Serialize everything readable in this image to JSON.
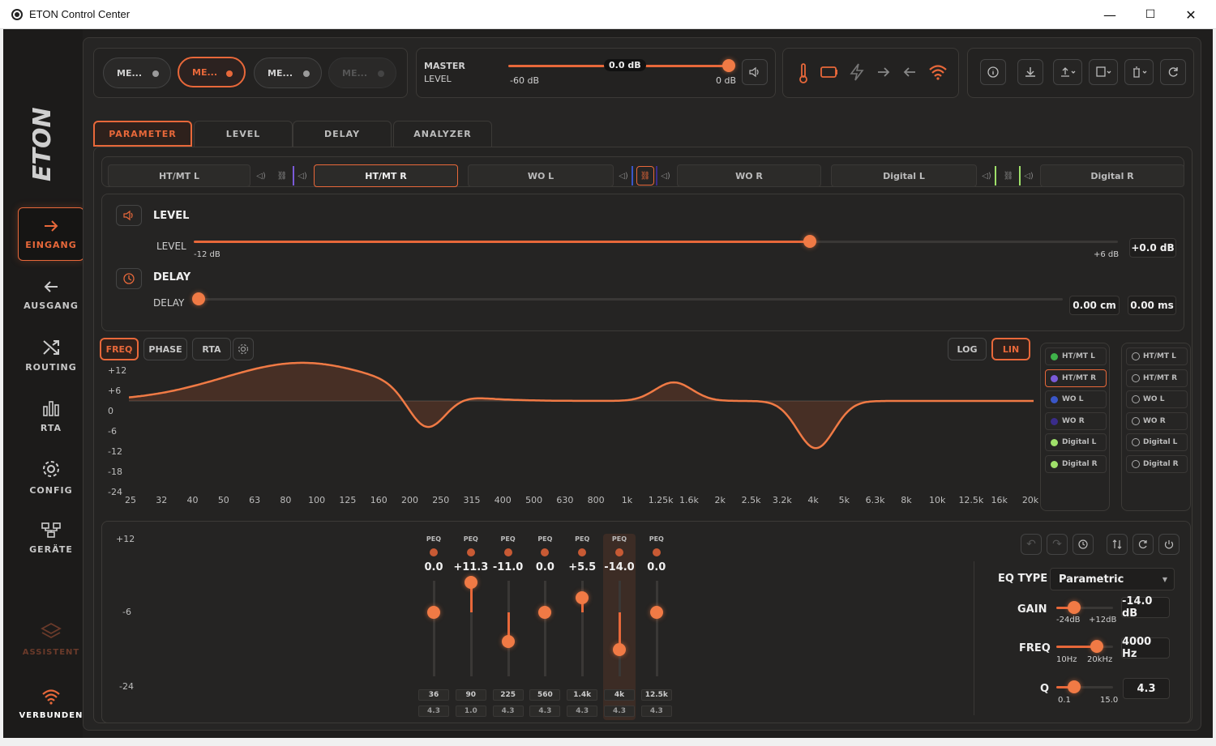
{
  "window": {
    "title": "ETON Control Center",
    "minimize": "—",
    "maximize": "☐",
    "close": "✕"
  },
  "sidebar": {
    "logo": "ETON",
    "items": [
      {
        "label": "EINGANG",
        "icon": "arrow-right-icon"
      },
      {
        "label": "AUSGANG",
        "icon": "arrow-left-icon"
      },
      {
        "label": "ROUTING",
        "icon": "shuffle-icon"
      },
      {
        "label": "RTA",
        "icon": "bar-chart-icon"
      },
      {
        "label": "CONFIG",
        "icon": "gear-icon"
      },
      {
        "label": "GERÄTE",
        "icon": "devices-icon"
      },
      {
        "label": "ASSISTENT",
        "icon": "layers-icon"
      },
      {
        "label": "VERBUNDEN",
        "icon": "wifi-icon"
      }
    ]
  },
  "memory": [
    "ME...",
    "ME...",
    "ME...",
    "ME..."
  ],
  "master": {
    "title": "MASTER",
    "sub": "LEVEL",
    "value": "0.0 dB",
    "min": "-60 dB",
    "max": "0 dB",
    "position": 1.0
  },
  "tabs": [
    "PARAMETER",
    "LEVEL",
    "DELAY",
    "ANALYZER"
  ],
  "channels": [
    "HT/MT L",
    "HT/MT R",
    "WO L",
    "WO R",
    "Digital L",
    "Digital R"
  ],
  "level_section": {
    "title": "LEVEL",
    "label": "LEVEL",
    "min": "-12 dB",
    "max": "+6 dB",
    "value": "+0.0 dB",
    "position": 0.667
  },
  "delay_section": {
    "title": "DELAY",
    "label": "DELAY",
    "cm": "0.00 cm",
    "ms": "0.00 ms",
    "position": 0.0
  },
  "graph_tabs": [
    "FREQ",
    "PHASE",
    "RTA"
  ],
  "scale_tabs": [
    "LOG",
    "LIN"
  ],
  "y_ticks": [
    "+12",
    "+6",
    "0",
    "-6",
    "-12",
    "-18",
    "-24"
  ],
  "x_ticks": [
    "25",
    "32",
    "40",
    "50",
    "63",
    "80",
    "100",
    "125",
    "160",
    "200",
    "250",
    "315",
    "400",
    "500",
    "630",
    "800",
    "1k",
    "1.25k",
    "1.6k",
    "2k",
    "2.5k",
    "3.2k",
    "4k",
    "5k",
    "6.3k",
    "8k",
    "10k",
    "12.5k",
    "16k",
    "20k"
  ],
  "legend_left": [
    {
      "label": "HT/MT L",
      "color": "#3fb24a"
    },
    {
      "label": "HT/MT R",
      "color": "#7a5ad8"
    },
    {
      "label": "WO L",
      "color": "#3a56c8"
    },
    {
      "label": "WO R",
      "color": "#3a2c8a"
    },
    {
      "label": "Digital L",
      "color": "#9fe06a"
    },
    {
      "label": "Digital R",
      "color": "#9fe06a"
    }
  ],
  "legend_right": [
    "HT/MT L",
    "HT/MT R",
    "WO L",
    "WO R",
    "Digital L",
    "Digital R"
  ],
  "eq_scale": [
    "+12",
    "-6",
    "-24"
  ],
  "bands": [
    {
      "type": "PEQ",
      "gain": "0.0",
      "freq": "36",
      "q": "4.3",
      "g": 0.0
    },
    {
      "type": "PEQ",
      "gain": "+11.3",
      "freq": "90",
      "q": "1.0",
      "g": 11.3
    },
    {
      "type": "PEQ",
      "gain": "-11.0",
      "freq": "225",
      "q": "4.3",
      "g": -11.0
    },
    {
      "type": "PEQ",
      "gain": "0.0",
      "freq": "560",
      "q": "4.3",
      "g": 0.0
    },
    {
      "type": "PEQ",
      "gain": "+5.5",
      "freq": "1.4k",
      "q": "4.3",
      "g": 5.5
    },
    {
      "type": "PEQ",
      "gain": "-14.0",
      "freq": "4k",
      "q": "4.3",
      "g": -14.0
    },
    {
      "type": "PEQ",
      "gain": "0.0",
      "freq": "12.5k",
      "q": "4.3",
      "g": 0.0
    }
  ],
  "eq_panel": {
    "type_label": "EQ TYPE",
    "type_value": "Parametric",
    "gain_label": "GAIN",
    "gain_min": "-24dB",
    "gain_max": "+12dB",
    "gain_value": "-14.0 dB",
    "freq_label": "FREQ",
    "freq_min": "10Hz",
    "freq_max": "20kHz",
    "freq_value": "4000 Hz",
    "q_label": "Q",
    "q_min": "0.1",
    "q_max": "15.0",
    "q_value": "4.3"
  },
  "colors": {
    "accent": "#e8683a",
    "bg": "#1f1e1d"
  }
}
